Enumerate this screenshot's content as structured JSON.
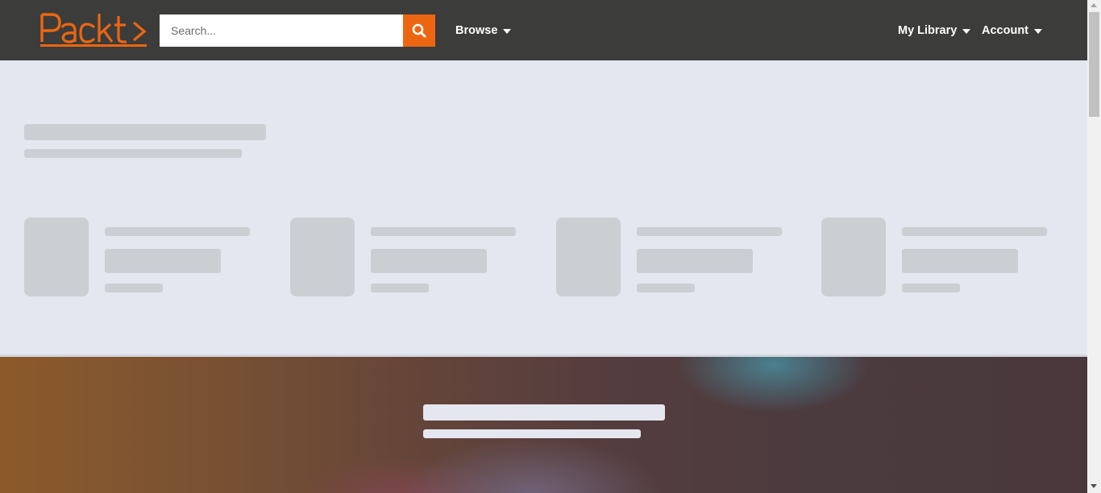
{
  "brand": {
    "logo_text": "Packt",
    "accent_color": "#ec6611",
    "header_color": "#3c3c3b"
  },
  "search": {
    "placeholder": "Search...",
    "icon": "search-icon"
  },
  "nav": {
    "browse_label": "Browse",
    "library_label": "My Library",
    "account_label": "Account",
    "dropdown_icon": "caret-down-icon"
  },
  "content_state": "loading-skeleton",
  "skeleton_color": "#cbced3",
  "background_color": "#e4e7ef"
}
